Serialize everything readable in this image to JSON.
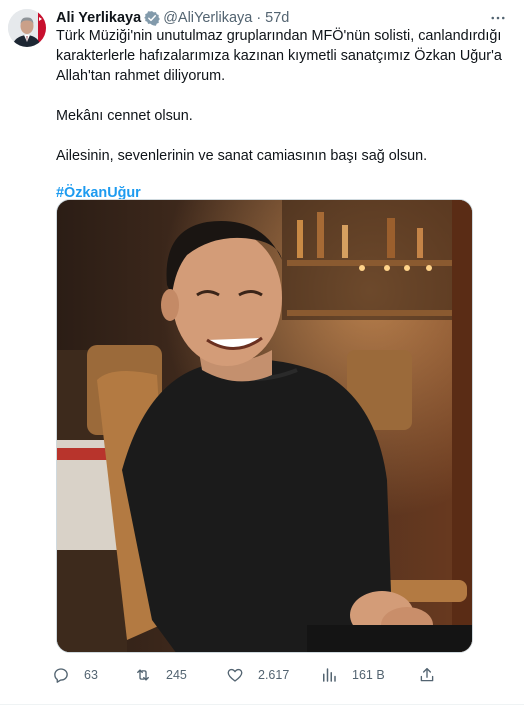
{
  "author": {
    "display_name": "Ali Yerlikaya",
    "handle": "@AliYerlikaya",
    "separator": "·",
    "time": "57d",
    "verified_icon": "verified-badge-icon",
    "verified_color": "#829aab"
  },
  "tweet": {
    "paragraphs": [
      "Türk Müziği'nin unutulmaz gruplarından MFÖ'nün solisti, canlandırdığı karakterlerle hafızalarımıza kazınan kıymetli sanatçımız Özkan Uğur'a Allah'tan rahmet diliyorum.",
      "Mekânı cennet olsun.",
      "Ailesinin, sevenlerinin ve sanat camiasının başı sağ olsun."
    ],
    "hashtag": "#ÖzkanUğur",
    "hashtag_color": "#1d9bf0"
  },
  "media": {
    "icon": "photo"
  },
  "actions": {
    "replies": "63",
    "retweets": "245",
    "likes": "2.617",
    "views": "161 B"
  },
  "colors": {
    "text": "#0f1419",
    "secondary": "#536471",
    "link": "#1d9bf0"
  }
}
